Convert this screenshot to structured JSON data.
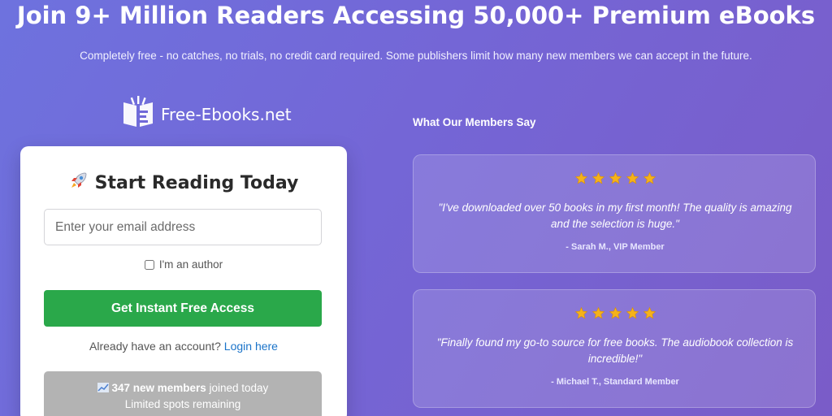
{
  "header": {
    "headline": "Join 9+ Million Readers Accessing 50,000+ Premium eBooks",
    "subline": "Completely free - no catches, no trials, no credit card required. Some publishers limit how many new members we can accept in the future."
  },
  "brand": {
    "name": "Free-Ebooks.net",
    "logo_icon": "open-book-icon"
  },
  "signup": {
    "title_icon": "rocket-icon",
    "title": "Start Reading Today",
    "email_placeholder": "Enter your email address",
    "email_value": "",
    "author_label": "I'm an author",
    "author_checked": false,
    "cta_label": "Get Instant Free Access",
    "login_prompt": "Already have an account?",
    "login_link": "Login here",
    "stats_icon": "chart-icon",
    "stats_count": "347 new members",
    "stats_suffix": " joined today",
    "stats_note": "Limited spots remaining"
  },
  "testimonials": {
    "title": "What Our Members Say",
    "items": [
      {
        "rating": 5,
        "quote": "\"I've downloaded over 50 books in my first month! The quality is amazing and the selection is huge.\"",
        "author": "- Sarah M., VIP Member"
      },
      {
        "rating": 5,
        "quote": "\"Finally found my go-to source for free books. The audiobook collection is incredible!\"",
        "author": "- Michael T., Standard Member"
      }
    ]
  },
  "colors": {
    "cta": "#2aa84a",
    "link": "#1a73c9",
    "star": "#f5b21a"
  }
}
